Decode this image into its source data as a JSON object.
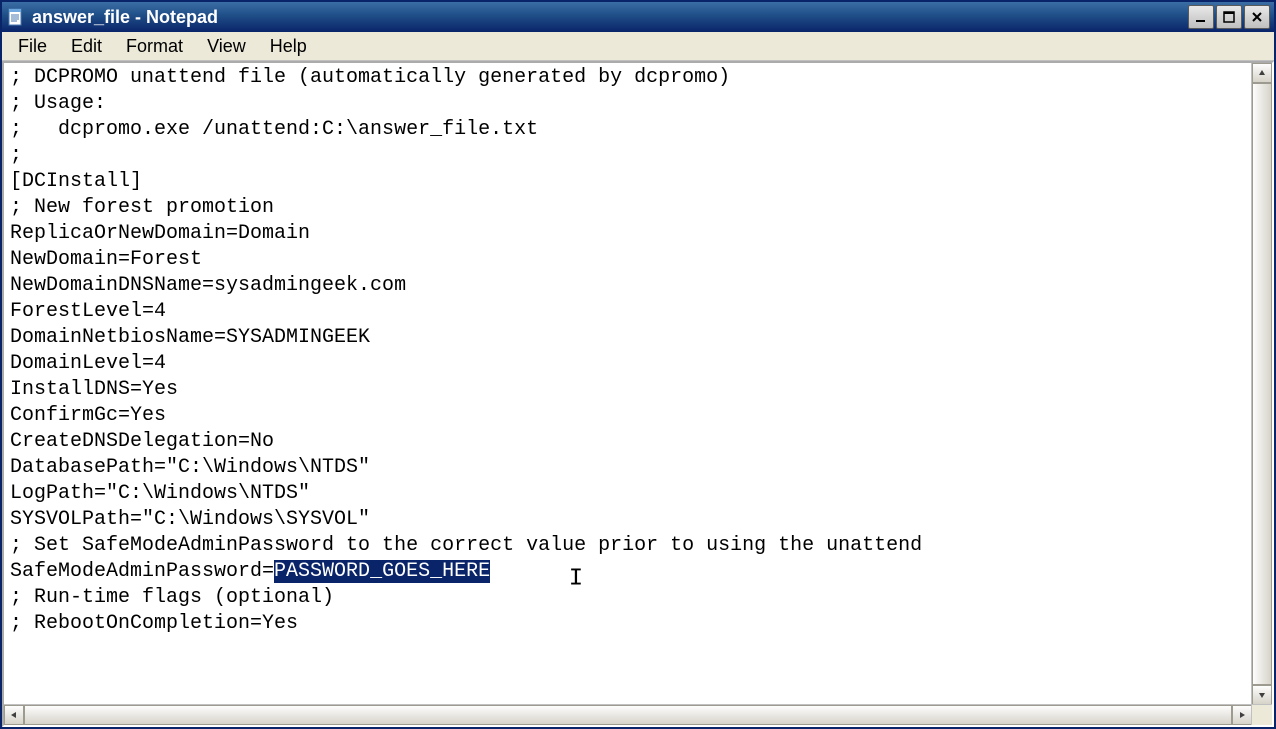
{
  "window": {
    "title": "answer_file - Notepad"
  },
  "menu": {
    "file": "File",
    "edit": "Edit",
    "format": "Format",
    "view": "View",
    "help": "Help"
  },
  "icons": {
    "app": "notepad-icon",
    "minimize": "minimize-icon",
    "maximize": "maximize-icon",
    "close": "close-icon"
  },
  "text": {
    "line1": "; DCPROMO unattend file (automatically generated by dcpromo)",
    "line2": "; Usage:",
    "line3": ";   dcpromo.exe /unattend:C:\\answer_file.txt",
    "line4": ";",
    "line5": "[DCInstall]",
    "line6": "; New forest promotion",
    "line7": "ReplicaOrNewDomain=Domain",
    "line8": "NewDomain=Forest",
    "line9": "NewDomainDNSName=sysadmingeek.com",
    "line10": "ForestLevel=4",
    "line11": "DomainNetbiosName=SYSADMINGEEK",
    "line12": "DomainLevel=4",
    "line13": "InstallDNS=Yes",
    "line14": "ConfirmGc=Yes",
    "line15": "CreateDNSDelegation=No",
    "line16": "DatabasePath=\"C:\\Windows\\NTDS\"",
    "line17": "LogPath=\"C:\\Windows\\NTDS\"",
    "line18": "SYSVOLPath=\"C:\\Windows\\SYSVOL\"",
    "line19": "; Set SafeModeAdminPassword to the correct value prior to using the unattend",
    "line20_a": "SafeModeAdminPassword=",
    "line20_sel": "PASSWORD_GOES_HERE",
    "line21": "; Run-time flags (optional)",
    "line22": "; RebootOnCompletion=Yes"
  }
}
